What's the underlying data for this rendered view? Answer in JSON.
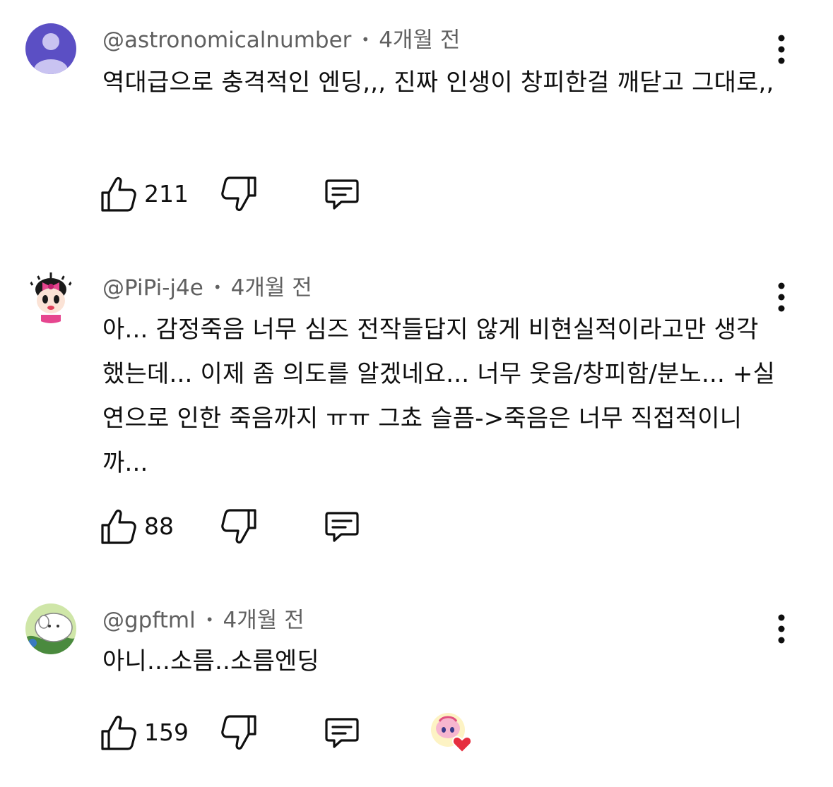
{
  "comments": [
    {
      "author": "@astronomicalnumber",
      "time": "4개월 전",
      "text": "역대급으로 충격적인 엔딩,,, 진짜 인생이 창피한걸 깨닫고 그대로,,",
      "likes": "211",
      "avatar_icon": "default-person-avatar",
      "creator_hearted": false
    },
    {
      "author": "@PiPi-j4e",
      "time": "4개월 전",
      "text": "아... 감정죽음 너무 심즈 전작들답지 않게 비현실적이라고만 생각했는데... 이제 좀 의도를 알겠네요... 너무 웃음/창피함/분노... +실연으로 인한 죽음까지 ㅠㅠ 그쵸 슬픔->죽음은 너무 직접적이니까...",
      "likes": "88",
      "avatar_icon": "cartoon-girl-avatar",
      "creator_hearted": false
    },
    {
      "author": "@gpftml",
      "time": "4개월 전",
      "text": "아니...소름..소름엔딩",
      "likes": "159",
      "avatar_icon": "cartoon-animal-avatar",
      "creator_hearted": true
    }
  ],
  "colors": {
    "text_primary": "#0f0f0f",
    "text_secondary": "#606060",
    "default_avatar_bg": "#5b4fc4",
    "heart": "#e62e3f"
  }
}
